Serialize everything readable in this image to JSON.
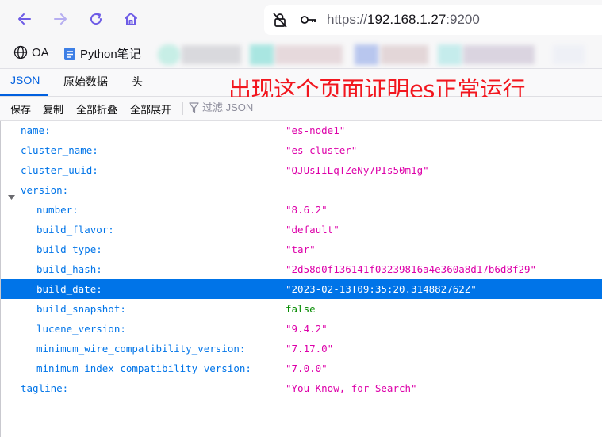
{
  "browser": {
    "url_scheme": "https://",
    "url_host": "192.168.1.27",
    "url_port": ":9200",
    "bookmarks": [
      {
        "label": "OA",
        "icon": "globe-icon"
      },
      {
        "label": "Python笔记",
        "icon": "document-icon"
      }
    ]
  },
  "viewer": {
    "tabs": [
      {
        "label": "JSON",
        "active": true
      },
      {
        "label": "原始数据",
        "active": false
      },
      {
        "label": "头",
        "active": false
      }
    ],
    "toolbar": {
      "save": "保存",
      "copy": "复制",
      "collapse_all": "全部折叠",
      "expand_all": "全部展开",
      "filter_placeholder": "过滤 JSON"
    }
  },
  "annotation": "出现这个页面证明es正常运行",
  "json_rows": [
    {
      "key": "name:",
      "value": "\"es-node1\"",
      "type": "string",
      "level": 0
    },
    {
      "key": "cluster_name:",
      "value": "\"es-cluster\"",
      "type": "string",
      "level": 0
    },
    {
      "key": "cluster_uuid:",
      "value": "\"QJUsIILqTZeNy7PIs50m1g\"",
      "type": "string",
      "level": 0
    },
    {
      "key": "version:",
      "value": "",
      "type": "object",
      "level": 0,
      "expanded": true
    },
    {
      "key": "number:",
      "value": "\"8.6.2\"",
      "type": "string",
      "level": 1
    },
    {
      "key": "build_flavor:",
      "value": "\"default\"",
      "type": "string",
      "level": 1
    },
    {
      "key": "build_type:",
      "value": "\"tar\"",
      "type": "string",
      "level": 1
    },
    {
      "key": "build_hash:",
      "value": "\"2d58d0f136141f03239816a4e360a8d17b6d8f29\"",
      "type": "string",
      "level": 1
    },
    {
      "key": "build_date:",
      "value": "\"2023-02-13T09:35:20.314882762Z\"",
      "type": "string",
      "level": 1,
      "selected": true
    },
    {
      "key": "build_snapshot:",
      "value": "false",
      "type": "boolean",
      "level": 1
    },
    {
      "key": "lucene_version:",
      "value": "\"9.4.2\"",
      "type": "string",
      "level": 1
    },
    {
      "key": "minimum_wire_compatibility_version:",
      "value": "\"7.17.0\"",
      "type": "string",
      "level": 1
    },
    {
      "key": "minimum_index_compatibility_version:",
      "value": "\"7.0.0\"",
      "type": "string",
      "level": 1
    },
    {
      "key": "tagline:",
      "value": "\"You Know, for Search\"",
      "type": "string",
      "level": 0
    }
  ],
  "colors": {
    "key": "#0074e8",
    "string": "#dd00a9",
    "boolean": "#058b00",
    "selection": "#0074e8",
    "annotation": "#f2161e",
    "nav_icon": "#6e5ce6"
  }
}
